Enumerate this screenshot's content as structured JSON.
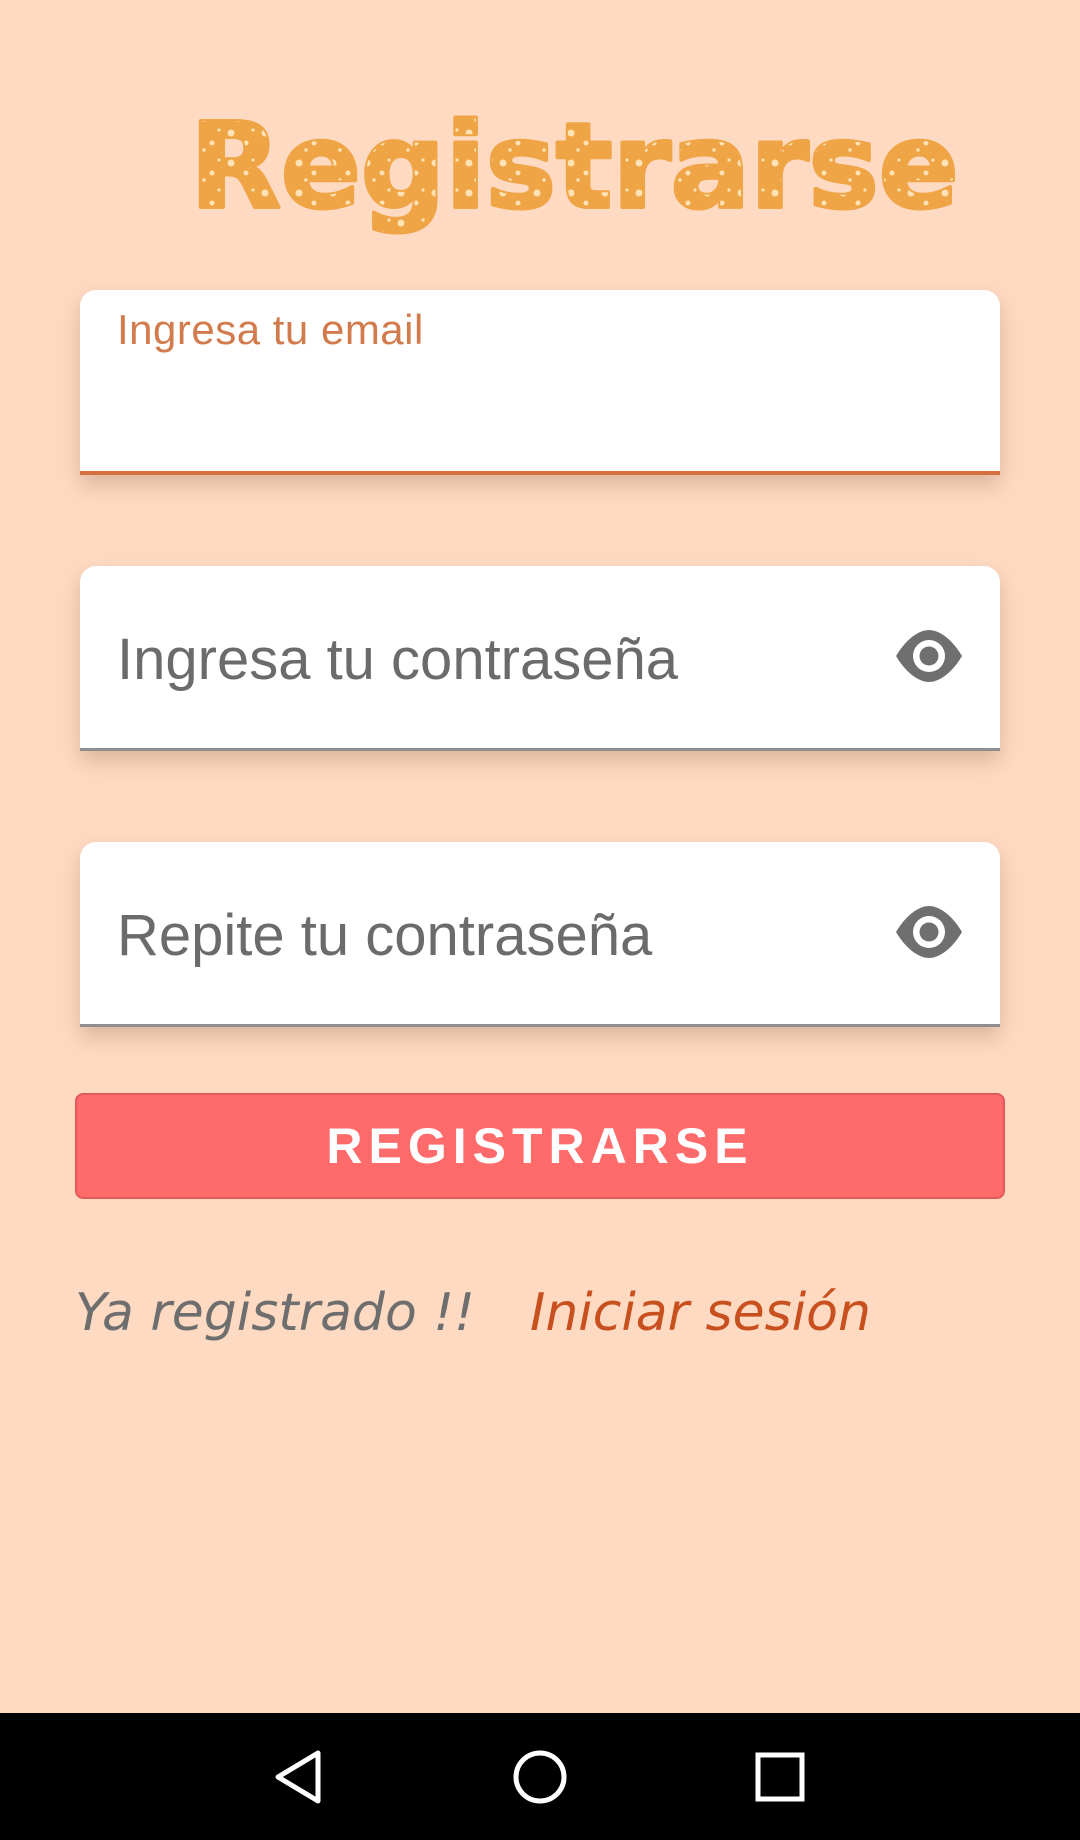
{
  "page": {
    "title": "Registrarse"
  },
  "form": {
    "email": {
      "label": "Ingresa tu email",
      "value": ""
    },
    "password": {
      "placeholder": "Ingresa tu contraseña",
      "toggle_icon": "eye-icon"
    },
    "repeat_password": {
      "placeholder": "Repite tu contraseña",
      "toggle_icon": "eye-icon"
    },
    "submit_label": "REGISTRARSE"
  },
  "footer": {
    "already_registered": "Ya registrado !!",
    "login_link": "Iniciar sesión"
  },
  "navbar": {
    "back_icon": "back-triangle-icon",
    "home_icon": "home-circle-icon",
    "recent_icon": "recent-square-icon"
  },
  "colors": {
    "background": "#FFDAC2",
    "title": "#EFA445",
    "accent": "#D3703F",
    "button": "#FF6B6B",
    "link": "#C8501E"
  }
}
